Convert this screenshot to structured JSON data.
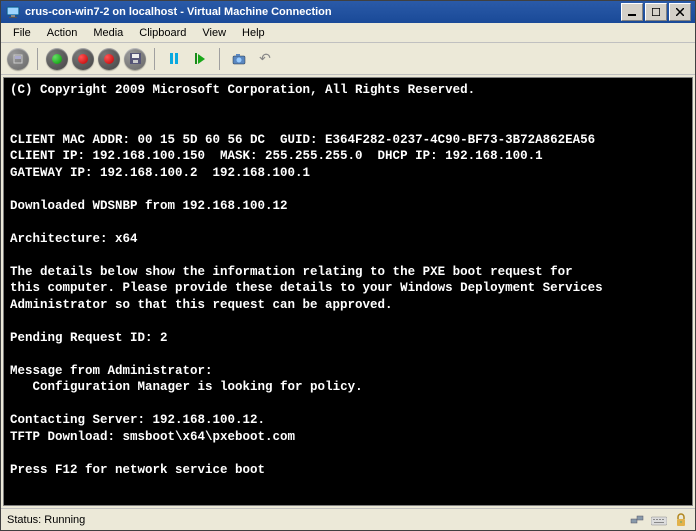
{
  "window": {
    "title": "crus-con-win7-2 on localhost - Virtual Machine Connection"
  },
  "menus": {
    "file": "File",
    "action": "Action",
    "media": "Media",
    "clipboard": "Clipboard",
    "view": "View",
    "help": "Help"
  },
  "toolbar_icons": {
    "cad": "ctrl-alt-del",
    "start": "start",
    "turnoff": "turn-off",
    "shutdown": "shutdown",
    "save": "save",
    "pause": "pause",
    "reset": "reset",
    "snapshot": "snapshot",
    "revert": "revert"
  },
  "console": {
    "lines": [
      "(C) Copyright 2009 Microsoft Corporation, All Rights Reserved.",
      "",
      "",
      "CLIENT MAC ADDR: 00 15 5D 60 56 DC  GUID: E364F282-0237-4C90-BF73-3B72A862EA56",
      "CLIENT IP: 192.168.100.150  MASK: 255.255.255.0  DHCP IP: 192.168.100.1",
      "GATEWAY IP: 192.168.100.2  192.168.100.1",
      "",
      "Downloaded WDSNBP from 192.168.100.12",
      "",
      "Architecture: x64",
      "",
      "The details below show the information relating to the PXE boot request for",
      "this computer. Please provide these details to your Windows Deployment Services",
      "Administrator so that this request can be approved.",
      "",
      "Pending Request ID: 2",
      "",
      "Message from Administrator:",
      "   Configuration Manager is looking for policy.",
      "",
      "Contacting Server: 192.168.100.12.",
      "TFTP Download: smsboot\\x64\\pxeboot.com",
      "",
      "Press F12 for network service boot"
    ]
  },
  "status": {
    "text": "Status: Running"
  }
}
